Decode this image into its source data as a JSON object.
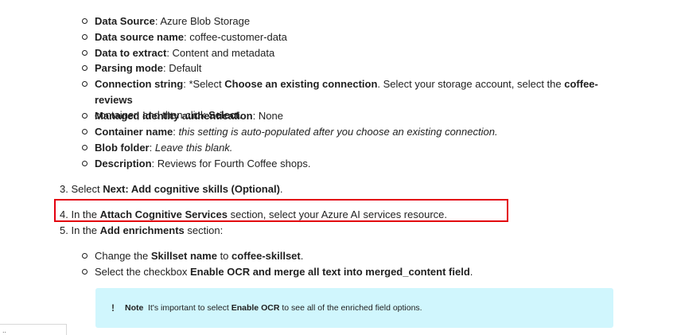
{
  "bullets_top": [
    {
      "key": "Data Source",
      "sep": ": ",
      "value": "Azure Blob Storage"
    },
    {
      "key": "Data source name",
      "sep": ": ",
      "value": "coffee-customer-data"
    },
    {
      "key": "Data to extract",
      "sep": ": ",
      "value": "Content and metadata"
    },
    {
      "key": "Parsing mode",
      "sep": ": ",
      "value": "Default"
    }
  ],
  "connection": {
    "key": "Connection string",
    "t1": ": *Select ",
    "b1": "Choose an existing connection",
    "t2": ". Select your storage account, select the ",
    "b2": "coffee-reviews",
    "t3": "container, and then click ",
    "b3": "Select",
    "t4": "."
  },
  "bullets_bottom": [
    {
      "key": "Managed identity authentication",
      "sep": ": ",
      "value": "None",
      "italic": false
    },
    {
      "key": "Container name",
      "sep": ": ",
      "value": "this setting is auto-populated after you choose an existing connection.",
      "italic": true
    },
    {
      "key": "Blob folder",
      "sep": ": ",
      "value": "Leave this blank.",
      "italic": true
    },
    {
      "key": "Description",
      "sep": ": ",
      "value": "Reviews for Fourth Coffee shops.",
      "italic": false
    }
  ],
  "step3": {
    "prefix": "3. Select ",
    "bold": "Next: Add cognitive skills (Optional)",
    "suffix": "."
  },
  "step4": {
    "prefix": "4. In the ",
    "bold": "Attach Cognitive Services",
    "suffix": " section, select your Azure AI services resource."
  },
  "step5": {
    "prefix": "5. In the ",
    "bold": "Add enrichments",
    "suffix": " section:"
  },
  "sub_bullets": {
    "skillset": {
      "t1": "Change the ",
      "b1": "Skillset name",
      "t2": " to ",
      "b2": "coffee-skillset",
      "t3": "."
    },
    "ocr": {
      "t1": "Select the checkbox ",
      "b1": "Enable OCR and merge all text into merged_content field",
      "t2": "."
    }
  },
  "note": {
    "icon": "!",
    "title": "Note",
    "t1": " It's important to select ",
    "b1": "Enable OCR",
    "t2": " to see all of the enriched field options."
  },
  "corner_text": "..",
  "colors": {
    "highlight_border": "#e3000f",
    "note_bg": "#d0f6fd"
  }
}
